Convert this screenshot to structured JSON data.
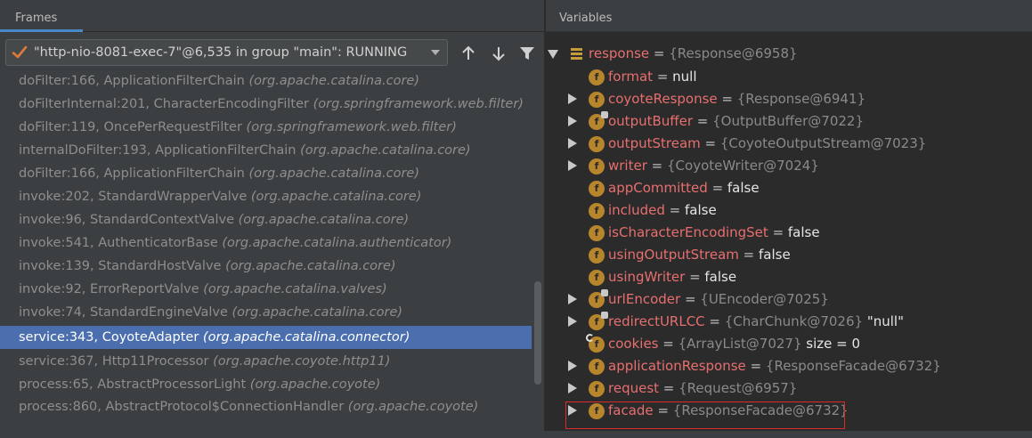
{
  "frames_panel": {
    "title": "Frames",
    "thread_selector": "\"http-nio-8081-exec-7\"@6,535 in group \"main\": RUNNING",
    "toolbar_icons": [
      "arrow-up-icon",
      "arrow-down-icon",
      "filter-icon"
    ],
    "frames": [
      {
        "method": "doFilter:166, ApplicationFilterChain",
        "pkg": "(org.apache.catalina.core)"
      },
      {
        "method": "doFilterInternal:201, CharacterEncodingFilter",
        "pkg": "(org.springframework.web.filter)"
      },
      {
        "method": "doFilter:119, OncePerRequestFilter",
        "pkg": "(org.springframework.web.filter)"
      },
      {
        "method": "internalDoFilter:193, ApplicationFilterChain",
        "pkg": "(org.apache.catalina.core)"
      },
      {
        "method": "doFilter:166, ApplicationFilterChain",
        "pkg": "(org.apache.catalina.core)"
      },
      {
        "method": "invoke:202, StandardWrapperValve",
        "pkg": "(org.apache.catalina.core)"
      },
      {
        "method": "invoke:96, StandardContextValve",
        "pkg": "(org.apache.catalina.core)"
      },
      {
        "method": "invoke:541, AuthenticatorBase",
        "pkg": "(org.apache.catalina.authenticator)"
      },
      {
        "method": "invoke:139, StandardHostValve",
        "pkg": "(org.apache.catalina.core)"
      },
      {
        "method": "invoke:92, ErrorReportValve",
        "pkg": "(org.apache.catalina.valves)"
      },
      {
        "method": "invoke:74, StandardEngineValve",
        "pkg": "(org.apache.catalina.core)"
      },
      {
        "method": "service:343, CoyoteAdapter",
        "pkg": "(org.apache.catalina.connector)"
      },
      {
        "method": "service:367, Http11Processor",
        "pkg": "(org.apache.coyote.http11)"
      },
      {
        "method": "process:65, AbstractProcessorLight",
        "pkg": "(org.apache.coyote)"
      },
      {
        "method": "process:860, AbstractProtocol$ConnectionHandler",
        "pkg": "(org.apache.coyote)"
      }
    ],
    "selected_frame": "service:343, CoyoteAdapter"
  },
  "variables_panel": {
    "title": "Variables",
    "rows": [
      {
        "name": "response",
        "eq": " = ",
        "value": "{Response@6958}",
        "extra": ""
      },
      {
        "name": "format",
        "eq": " = ",
        "value": "null",
        "extra": ""
      },
      {
        "name": "coyoteResponse",
        "eq": " = ",
        "value": "{Response@6941}",
        "extra": ""
      },
      {
        "name": "outputBuffer",
        "eq": " = ",
        "value": "{OutputBuffer@7022}",
        "extra": ""
      },
      {
        "name": "outputStream",
        "eq": " = ",
        "value": "{CoyoteOutputStream@7023}",
        "extra": ""
      },
      {
        "name": "writer",
        "eq": " = ",
        "value": "{CoyoteWriter@7024}",
        "extra": ""
      },
      {
        "name": "appCommitted",
        "eq": " = ",
        "value": "false",
        "extra": ""
      },
      {
        "name": "included",
        "eq": " = ",
        "value": "false",
        "extra": ""
      },
      {
        "name": "isCharacterEncodingSet",
        "eq": " = ",
        "value": "false",
        "extra": ""
      },
      {
        "name": "usingOutputStream",
        "eq": " = ",
        "value": "false",
        "extra": ""
      },
      {
        "name": "usingWriter",
        "eq": " = ",
        "value": "false",
        "extra": ""
      },
      {
        "name": "urlEncoder",
        "eq": " = ",
        "value": "{UEncoder@7025}",
        "extra": ""
      },
      {
        "name": "redirectURLCC",
        "eq": " = ",
        "value": "{CharChunk@7026}",
        "extra": " \"null\""
      },
      {
        "name": "cookies",
        "eq": " = ",
        "value": "{ArrayList@7027}",
        "extra": "  size = 0"
      },
      {
        "name": "applicationResponse",
        "eq": " = ",
        "value": "{ResponseFacade@6732}",
        "extra": ""
      },
      {
        "name": "request",
        "eq": " = ",
        "value": "{Request@6957}",
        "extra": ""
      },
      {
        "name": "facade",
        "eq": " = ",
        "value": "{ResponseFacade@6732}",
        "extra": ""
      }
    ],
    "highlighted_row": "facade"
  },
  "colors": {
    "selection": "#4b6eaf",
    "field_name": "#e76f6f",
    "field_icon": "#b7852c",
    "highlight_border": "#d62c2c"
  }
}
